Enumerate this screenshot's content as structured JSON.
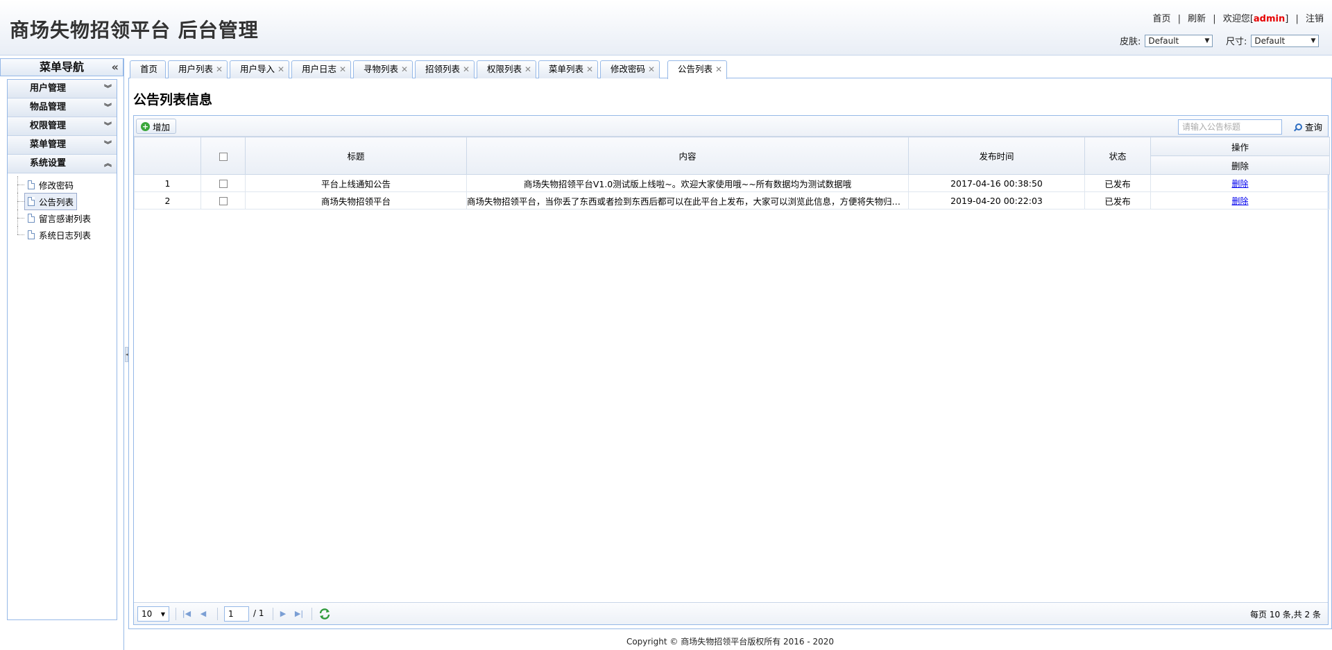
{
  "header": {
    "title": "商场失物招领平台 后台管理",
    "links": {
      "home": "首页",
      "refresh": "刷新",
      "welcome": "欢迎您[",
      "user": "admin",
      "welcome_end": "]",
      "logout": "注销",
      "sep": "|"
    },
    "skin": {
      "label": "皮肤:",
      "value": "Default"
    },
    "size": {
      "label": "尺寸:",
      "value": "Default"
    }
  },
  "sidebar": {
    "title": "菜单导航",
    "collapse": "«",
    "groups": [
      {
        "label": "用户管理",
        "chev": "¥"
      },
      {
        "label": "物品管理",
        "chev": "¥"
      },
      {
        "label": "权限管理",
        "chev": "¥"
      },
      {
        "label": "菜单管理",
        "chev": "¥"
      },
      {
        "label": "系统设置",
        "chev": "ˆ"
      }
    ],
    "tree": [
      "修改密码",
      "公告列表",
      "留言感谢列表",
      "系统日志列表"
    ]
  },
  "tabs": [
    {
      "label": "首页"
    },
    {
      "label": "用户列表"
    },
    {
      "label": "用户导入"
    },
    {
      "label": "用户日志"
    },
    {
      "label": "寻物列表"
    },
    {
      "label": "招领列表"
    },
    {
      "label": "权限列表"
    },
    {
      "label": "菜单列表"
    },
    {
      "label": "修改密码"
    },
    {
      "label": "公告列表"
    }
  ],
  "close_glyph": "✕",
  "page": {
    "title": "公告列表信息",
    "toolbar": {
      "add": "增加",
      "search_placeholder": "请输入公告标题",
      "search": "查询"
    },
    "columns": {
      "title": "标题",
      "content": "内容",
      "time": "发布时间",
      "status": "状态",
      "ops": "操作",
      "ops_sub": "删除"
    },
    "rows": [
      {
        "no": "1",
        "title": "平台上线通知公告",
        "content": "商场失物招领平台V1.0测试版上线啦~。欢迎大家使用哦~~所有数据均为测试数据哦",
        "time": "2017-04-16 00:38:50",
        "status": "已发布",
        "op": "删除"
      },
      {
        "no": "2",
        "title": "商场失物招领平台",
        "content": "商场失物招领平台，当你丢了东西或者捡到东西后都可以在此平台上发布，大家可以浏览此信息，方便将失物归还及...",
        "time": "2019-04-20 00:22:03",
        "status": "已发布",
        "op": "删除"
      }
    ],
    "pager": {
      "size": "10",
      "page": "1",
      "total": "/ 1",
      "info": "每页 10 条,共 2 条"
    }
  },
  "footer": "Copyright © 商场失物招领平台版权所有  2016 - 2020"
}
